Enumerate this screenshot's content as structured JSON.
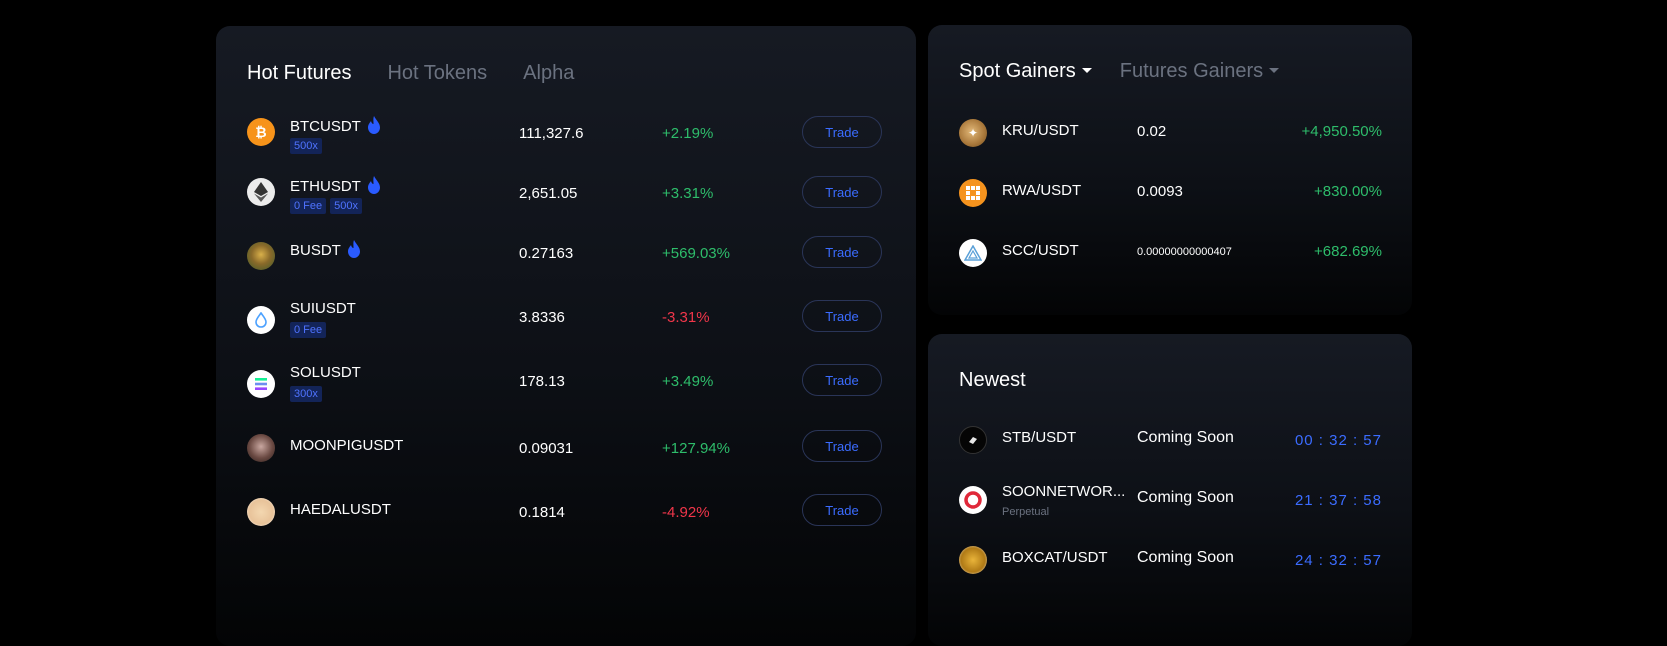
{
  "futures": {
    "tabs": [
      {
        "label": "Hot Futures",
        "active": true
      },
      {
        "label": "Hot Tokens",
        "active": false
      },
      {
        "label": "Alpha",
        "active": false
      }
    ],
    "trade_label": "Trade",
    "rows": [
      {
        "symbol": "BTCUSDT",
        "icon": "bitcoin-icon",
        "hot": true,
        "badges": [
          "500x"
        ],
        "price": "111,327.6",
        "change": "+2.19%",
        "dir": "up"
      },
      {
        "symbol": "ETHUSDT",
        "icon": "ethereum-icon",
        "hot": true,
        "badges": [
          "0 Fee",
          "500x"
        ],
        "price": "2,651.05",
        "change": "+3.31%",
        "dir": "up"
      },
      {
        "symbol": "BUSDT",
        "icon": "b-token-icon",
        "hot": true,
        "badges": [],
        "price": "0.27163",
        "change": "+569.03%",
        "dir": "up"
      },
      {
        "symbol": "SUIUSDT",
        "icon": "sui-icon",
        "hot": false,
        "badges": [
          "0 Fee"
        ],
        "price": "3.8336",
        "change": "-3.31%",
        "dir": "down"
      },
      {
        "symbol": "SOLUSDT",
        "icon": "solana-icon",
        "hot": false,
        "badges": [
          "300x"
        ],
        "price": "178.13",
        "change": "+3.49%",
        "dir": "up"
      },
      {
        "symbol": "MOONPIGUSDT",
        "icon": "moonpig-icon",
        "hot": false,
        "badges": [],
        "price": "0.09031",
        "change": "+127.94%",
        "dir": "up"
      },
      {
        "symbol": "HAEDALUSDT",
        "icon": "haedal-icon",
        "hot": false,
        "badges": [],
        "price": "0.1814",
        "change": "-4.92%",
        "dir": "down"
      }
    ]
  },
  "gainers": {
    "tabs": [
      {
        "label": "Spot Gainers",
        "active": true
      },
      {
        "label": "Futures Gainers",
        "active": false
      }
    ],
    "rows": [
      {
        "pair": "KRU/USDT",
        "icon": "kru-icon",
        "price": "0.02",
        "change": "+4,950.50%"
      },
      {
        "pair": "RWA/USDT",
        "icon": "rwa-icon",
        "price": "0.0093",
        "change": "+830.00%"
      },
      {
        "pair": "SCC/USDT",
        "icon": "scc-icon",
        "price": "0.00000000000407",
        "change": "+682.69%"
      }
    ]
  },
  "newest": {
    "title": "Newest",
    "rows": [
      {
        "pair": "STB/USDT",
        "icon": "stb-icon",
        "sub": "",
        "status": "Coming Soon",
        "timer": "00 : 32 : 57"
      },
      {
        "pair": "SOONNETWOR...",
        "icon": "soon-network-icon",
        "sub": "Perpetual",
        "status": "Coming Soon",
        "timer": "21 : 37 : 58"
      },
      {
        "pair": "BOXCAT/USDT",
        "icon": "boxcat-icon",
        "sub": "",
        "status": "Coming Soon",
        "timer": "24 : 32 : 57"
      }
    ]
  },
  "colors": {
    "up": "#2ebd6b",
    "down": "#f0364a",
    "accent": "#3b6cff"
  }
}
